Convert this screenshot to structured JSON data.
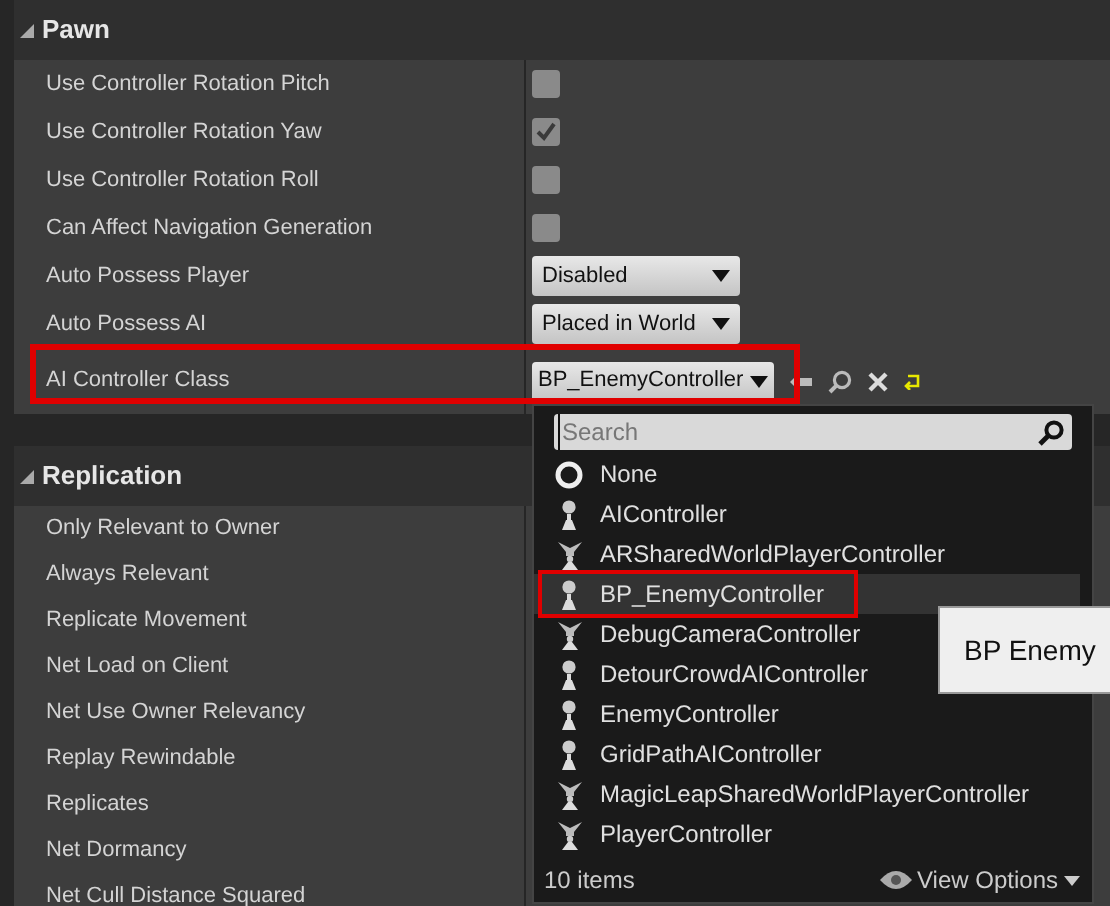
{
  "sections": [
    {
      "title": "Pawn",
      "expanded": true,
      "rows": [
        {
          "label": "Use Controller Rotation Pitch",
          "kind": "checkbox",
          "checked": false,
          "highlighted": false
        },
        {
          "label": "Use Controller Rotation Yaw",
          "kind": "checkbox",
          "checked": true,
          "highlighted": false
        },
        {
          "label": "Use Controller Rotation Roll",
          "kind": "checkbox",
          "checked": false,
          "highlighted": false
        },
        {
          "label": "Can Affect Navigation Generation",
          "kind": "checkbox",
          "checked": false,
          "highlighted": false
        },
        {
          "label": "Auto Possess Player",
          "kind": "dropdown",
          "value": "Disabled",
          "highlighted": false
        },
        {
          "label": "Auto Possess AI",
          "kind": "dropdown",
          "value": "Placed in World",
          "highlighted": false
        },
        {
          "label": "AI Controller Class",
          "kind": "class",
          "value": "BP_EnemyController",
          "highlighted": true
        }
      ]
    },
    {
      "title": "Replication",
      "expanded": true,
      "rows": [
        {
          "label": "Only Relevant to Owner"
        },
        {
          "label": "Always Relevant"
        },
        {
          "label": "Replicate Movement"
        },
        {
          "label": "Net Load on Client"
        },
        {
          "label": "Net Use Owner Relevancy"
        },
        {
          "label": "Replay Rewindable"
        },
        {
          "label": "Replicates"
        },
        {
          "label": "Net Dormancy"
        },
        {
          "label": "Net Cull Distance Squared"
        }
      ]
    }
  ],
  "class_picker": {
    "search": {
      "placeholder": "Search"
    },
    "items": [
      {
        "label": "None",
        "kind": "none",
        "selected": false,
        "highlighted": false
      },
      {
        "label": "AIController",
        "kind": "pawn",
        "selected": false,
        "highlighted": false
      },
      {
        "label": "ARSharedWorldPlayerController",
        "kind": "player",
        "selected": false,
        "highlighted": false
      },
      {
        "label": "BP_EnemyController",
        "kind": "pawn",
        "selected": true,
        "highlighted": true
      },
      {
        "label": "DebugCameraController",
        "kind": "player",
        "selected": false,
        "highlighted": false
      },
      {
        "label": "DetourCrowdAIController",
        "kind": "pawn",
        "selected": false,
        "highlighted": false
      },
      {
        "label": "EnemyController",
        "kind": "pawn",
        "selected": false,
        "highlighted": false
      },
      {
        "label": "GridPathAIController",
        "kind": "pawn",
        "selected": false,
        "highlighted": false
      },
      {
        "label": "MagicLeapSharedWorldPlayerController",
        "kind": "player",
        "selected": false,
        "highlighted": false
      },
      {
        "label": "PlayerController",
        "kind": "player",
        "selected": false,
        "highlighted": false
      }
    ],
    "count": "10 items",
    "view_options": "View Options"
  },
  "tooltip": "BP Enemy"
}
